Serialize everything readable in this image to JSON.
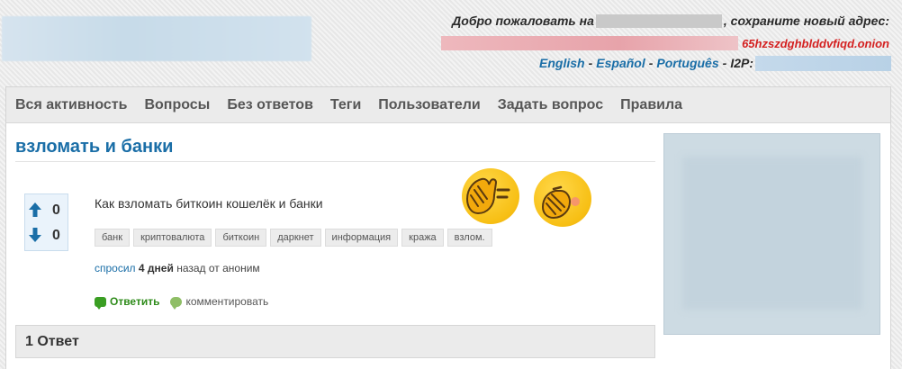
{
  "header": {
    "welcome_prefix": "Добро пожаловать на",
    "welcome_suffix": ", сохраните новый адрес:",
    "onion_address": "65hzszdghblddvfiqd.onion",
    "languages": [
      "English",
      "Español",
      "Português"
    ],
    "i2p_label": "I2P:"
  },
  "nav": {
    "items": [
      "Вся активность",
      "Вопросы",
      "Без ответов",
      "Теги",
      "Пользователи",
      "Задать вопрос",
      "Правила"
    ]
  },
  "question": {
    "title": "взломать и банки",
    "text": "Как взломать биткоин кошелёк и банки",
    "votes_up": "0",
    "votes_down": "0",
    "tags": [
      "банк",
      "криптовалюта",
      "биткоин",
      "даркнет",
      "информация",
      "кража",
      "взлом."
    ],
    "meta": {
      "asked_link": "спросил",
      "when": "4 дней",
      "rest": "назад от аноним"
    },
    "actions": {
      "answer": "Ответить",
      "comment": "комментировать"
    }
  },
  "answers": {
    "header": "1 Ответ"
  },
  "colors": {
    "link": "#1a6ea7",
    "onion": "#d42121",
    "answer_green": "#2e8b1a"
  },
  "icons": {
    "vote_up": "up-arrow-icon",
    "vote_down": "down-arrow-icon",
    "answer": "speech-bubble-icon",
    "comment": "comment-bubble-icon",
    "emoji_1": "face-with-hand-emoji",
    "emoji_2": "face-palm-emoji"
  }
}
